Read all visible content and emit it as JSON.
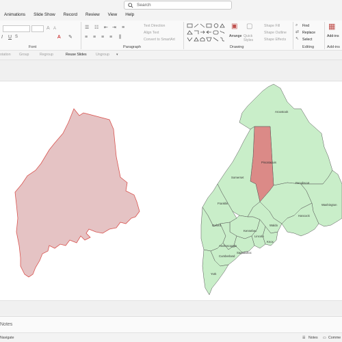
{
  "search": {
    "placeholder": "Search"
  },
  "menu": [
    "Animations",
    "Slide Show",
    "Record",
    "Review",
    "View",
    "Help"
  ],
  "ribbon": {
    "font": {
      "label": "Font"
    },
    "paragraph": {
      "label": "Paragraph",
      "text_direction": "Text Direction",
      "align_text": "Align Text",
      "convert_smartart": "Convert to SmartArt"
    },
    "drawing": {
      "label": "Drawing",
      "arrange": "Arrange",
      "quick_styles": "Quick Styles",
      "shape_fill": "Shape Fill",
      "shape_outline": "Shape Outline",
      "shape_effects": "Shape Effects"
    },
    "editing": {
      "label": "Editing",
      "find": "Find",
      "replace": "Replace",
      "select": "Select"
    },
    "addins": {
      "label": "Add-ins",
      "button": "Add-ins"
    }
  },
  "strip": {
    "rotation": "otation",
    "ungroup_prefix": "Group",
    "regroup": "Regroup",
    "reuse_slides": "Reuse Slides",
    "ungroup": "Ungroup"
  },
  "map": {
    "counties": [
      "Aroostook",
      "Piscataquis",
      "Somerset",
      "Penobscot",
      "Franklin",
      "Washington",
      "Hancock",
      "Waldo",
      "Oxford",
      "Kennebec",
      "Androscoggin",
      "Knox",
      "Lincoln",
      "Sagadahoc",
      "Cumberland",
      "York"
    ],
    "highlighted": "Piscataquis",
    "colors": {
      "state_fill": "#e5c3c4",
      "state_stroke": "#d9534f",
      "county_fill": "#c9eec9",
      "county_stroke": "#555555",
      "highlight_fill": "#db8a87"
    }
  },
  "notes": {
    "label": "Notes"
  },
  "status": {
    "left": "Navigate",
    "notes": "Notes",
    "comments": "Comme"
  }
}
